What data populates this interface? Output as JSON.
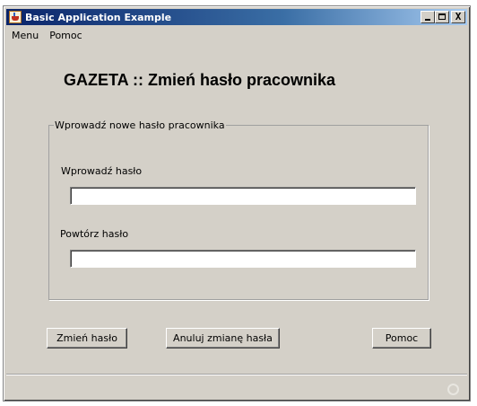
{
  "window": {
    "title": "Basic Application Example",
    "controls": {
      "minimize": "_",
      "maximize": "□",
      "close": "X"
    }
  },
  "menubar": {
    "items": [
      "Menu",
      "Pomoc"
    ]
  },
  "page": {
    "title": "GAZETA :: Zmień hasło pracownika"
  },
  "group": {
    "legend": "Wprowadź nowe hasło pracownika",
    "password_label": "Wprowadź hasło",
    "password_value": "",
    "repeat_label": "Powtórz hasło",
    "repeat_value": ""
  },
  "actions": {
    "change": "Zmień hasło",
    "cancel": "Anuluj zmianę hasła",
    "help": "Pomoc"
  },
  "icons": {
    "app": "java-coffee-cup-icon",
    "status": "busy-indicator-icon"
  }
}
